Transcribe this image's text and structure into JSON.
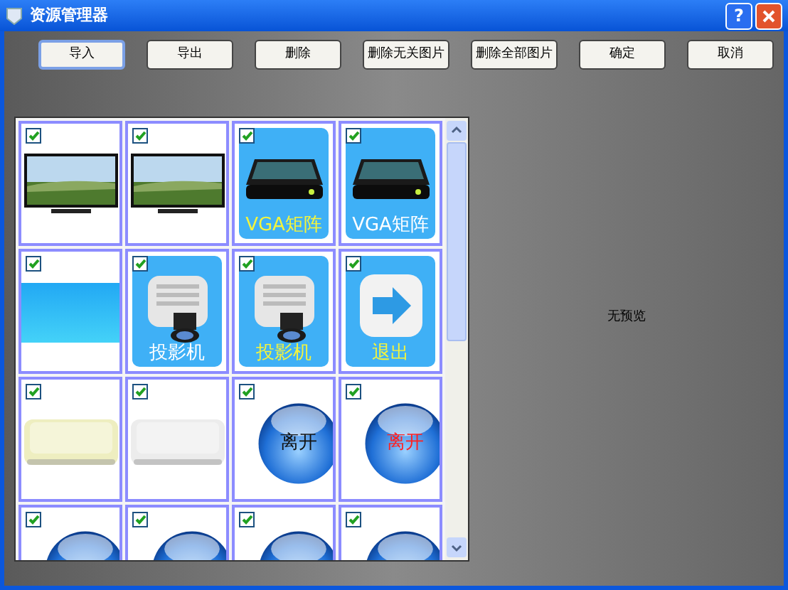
{
  "window": {
    "title": "资源管理器",
    "help": "?"
  },
  "buttons": [
    {
      "label": "导入",
      "focused": true
    },
    {
      "label": "导出",
      "focused": false
    },
    {
      "label": "删除",
      "focused": false
    },
    {
      "label": "删除无关图片",
      "focused": false
    },
    {
      "label": "删除全部图片",
      "focused": false
    },
    {
      "label": "确定",
      "focused": false
    },
    {
      "label": "取消",
      "focused": false
    }
  ],
  "tiles": [
    {
      "kind": "tv",
      "checked": true
    },
    {
      "kind": "tv",
      "checked": true
    },
    {
      "kind": "vga",
      "checked": true,
      "label": "VGA矩阵",
      "color": "#f4f43c"
    },
    {
      "kind": "vga",
      "checked": true,
      "label": "VGA矩阵",
      "color": "#ffffff"
    },
    {
      "kind": "bar",
      "checked": true
    },
    {
      "kind": "projector",
      "checked": true,
      "label": "投影机",
      "color": "#ffffff"
    },
    {
      "kind": "projector",
      "checked": true,
      "label": "投影机",
      "color": "#f4f43c"
    },
    {
      "kind": "exit",
      "checked": true,
      "label": "退出",
      "color": "#f4f43c"
    },
    {
      "kind": "key",
      "checked": true,
      "color": "#eeeec0"
    },
    {
      "kind": "key",
      "checked": true,
      "color": "#ececec"
    },
    {
      "kind": "orb",
      "checked": true,
      "label": "离开",
      "color": "#111111"
    },
    {
      "kind": "orb",
      "checked": true,
      "label": "离开",
      "color": "#ff2020"
    },
    {
      "kind": "orb",
      "checked": true
    },
    {
      "kind": "orb",
      "checked": true
    },
    {
      "kind": "orb",
      "checked": true
    },
    {
      "kind": "orb",
      "checked": true
    }
  ],
  "preview": {
    "text": "无预览"
  }
}
